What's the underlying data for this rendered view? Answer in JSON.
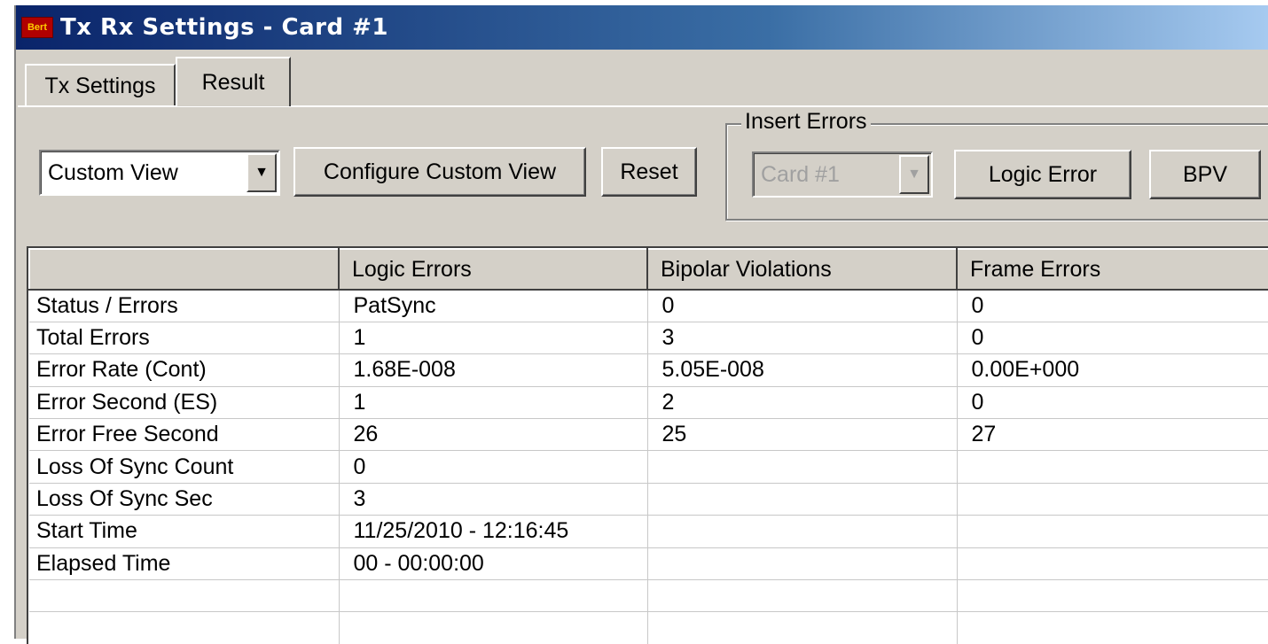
{
  "window": {
    "title": "Tx Rx Settings - Card #1",
    "icon_label": "Bert",
    "icon": "app-icon"
  },
  "tabs": [
    {
      "label": "Tx Settings",
      "active": false
    },
    {
      "label": "Result",
      "active": true
    }
  ],
  "toolbar": {
    "view_select": "Custom View",
    "configure_button": "Configure Custom View",
    "reset_button": "Reset"
  },
  "insert_errors": {
    "legend": "Insert Errors",
    "card_select": "Card #1",
    "logic_error_button": "Logic Error",
    "bpv_button": "BPV"
  },
  "table": {
    "headers": [
      "",
      "Logic Errors",
      "Bipolar Violations",
      "Frame Errors"
    ],
    "rows": [
      [
        "Status / Errors",
        "PatSync",
        "0",
        "0"
      ],
      [
        "Total Errors",
        "1",
        "3",
        "0"
      ],
      [
        "Error Rate (Cont)",
        "1.68E-008",
        "5.05E-008",
        "0.00E+000"
      ],
      [
        "Error Second (ES)",
        "1",
        "2",
        "0"
      ],
      [
        "Error Free Second",
        "26",
        "25",
        "27"
      ],
      [
        "Loss Of Sync Count",
        "0",
        "",
        ""
      ],
      [
        "Loss Of Sync Sec",
        "3",
        "",
        ""
      ],
      [
        "Start Time",
        "11/25/2010 - 12:16:45",
        "",
        ""
      ],
      [
        "Elapsed Time",
        "00 - 00:00:00",
        "",
        ""
      ],
      [
        "",
        "",
        "",
        ""
      ],
      [
        "",
        "",
        "",
        ""
      ]
    ]
  }
}
